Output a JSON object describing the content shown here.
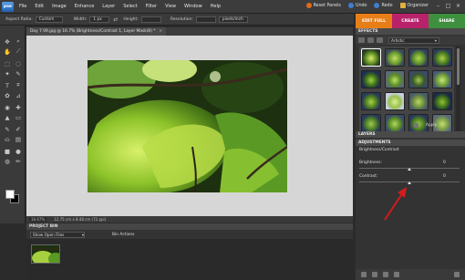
{
  "app": {
    "logo": "pse"
  },
  "menu": [
    "File",
    "Edit",
    "Image",
    "Enhance",
    "Layer",
    "Select",
    "Filter",
    "View",
    "Window",
    "Help"
  ],
  "top_buttons": [
    {
      "label": "Reset Panels",
      "icon": "reset-panels-icon",
      "color": "#e06a1a"
    },
    {
      "label": "Undo",
      "icon": "undo-icon",
      "color": "#3e7fcf"
    },
    {
      "label": "Redo",
      "icon": "redo-icon",
      "color": "#3e7fcf"
    },
    {
      "label": "Organizer",
      "icon": "organizer-icon",
      "color": "#e0b040"
    }
  ],
  "options_bar": {
    "aspect_label": "Aspect Ratio:",
    "aspect_value": "Custom",
    "width_label": "Width:",
    "width_value": "1 px",
    "height_label": "Height:",
    "resolution_label": "Resolution:",
    "resolution_unit": "pixels/inch"
  },
  "mode_tabs": [
    {
      "label": "EDIT FULL",
      "color": "#e87e17"
    },
    {
      "label": "CREATE",
      "color": "#b8226a"
    },
    {
      "label": "SHARE",
      "color": "#3e8f3e"
    }
  ],
  "document": {
    "tab_title": "Day 7 09.jpg @ 16.7% (Brightness/Contrast 1, Layer Mask/8) *",
    "zoom": "16.67%",
    "info": "12.75 cm x 8.48 cm (72 ppi)"
  },
  "project_bin": {
    "title": "PROJECT BIN",
    "show_label": "Show Open Files",
    "actions_label": "Bin Actions"
  },
  "panel": {
    "effects_title": "EFFECTS",
    "effects_filter": "Artistic",
    "apply_label": "Apply",
    "layers_title": "LAYERS",
    "adjustments_title": "ADJUSTMENTS",
    "adjustment_name": "Brightness/Contrast",
    "brightness_label": "Brightness:",
    "brightness_value": "0",
    "contrast_label": "Contrast:",
    "contrast_value": "0"
  }
}
